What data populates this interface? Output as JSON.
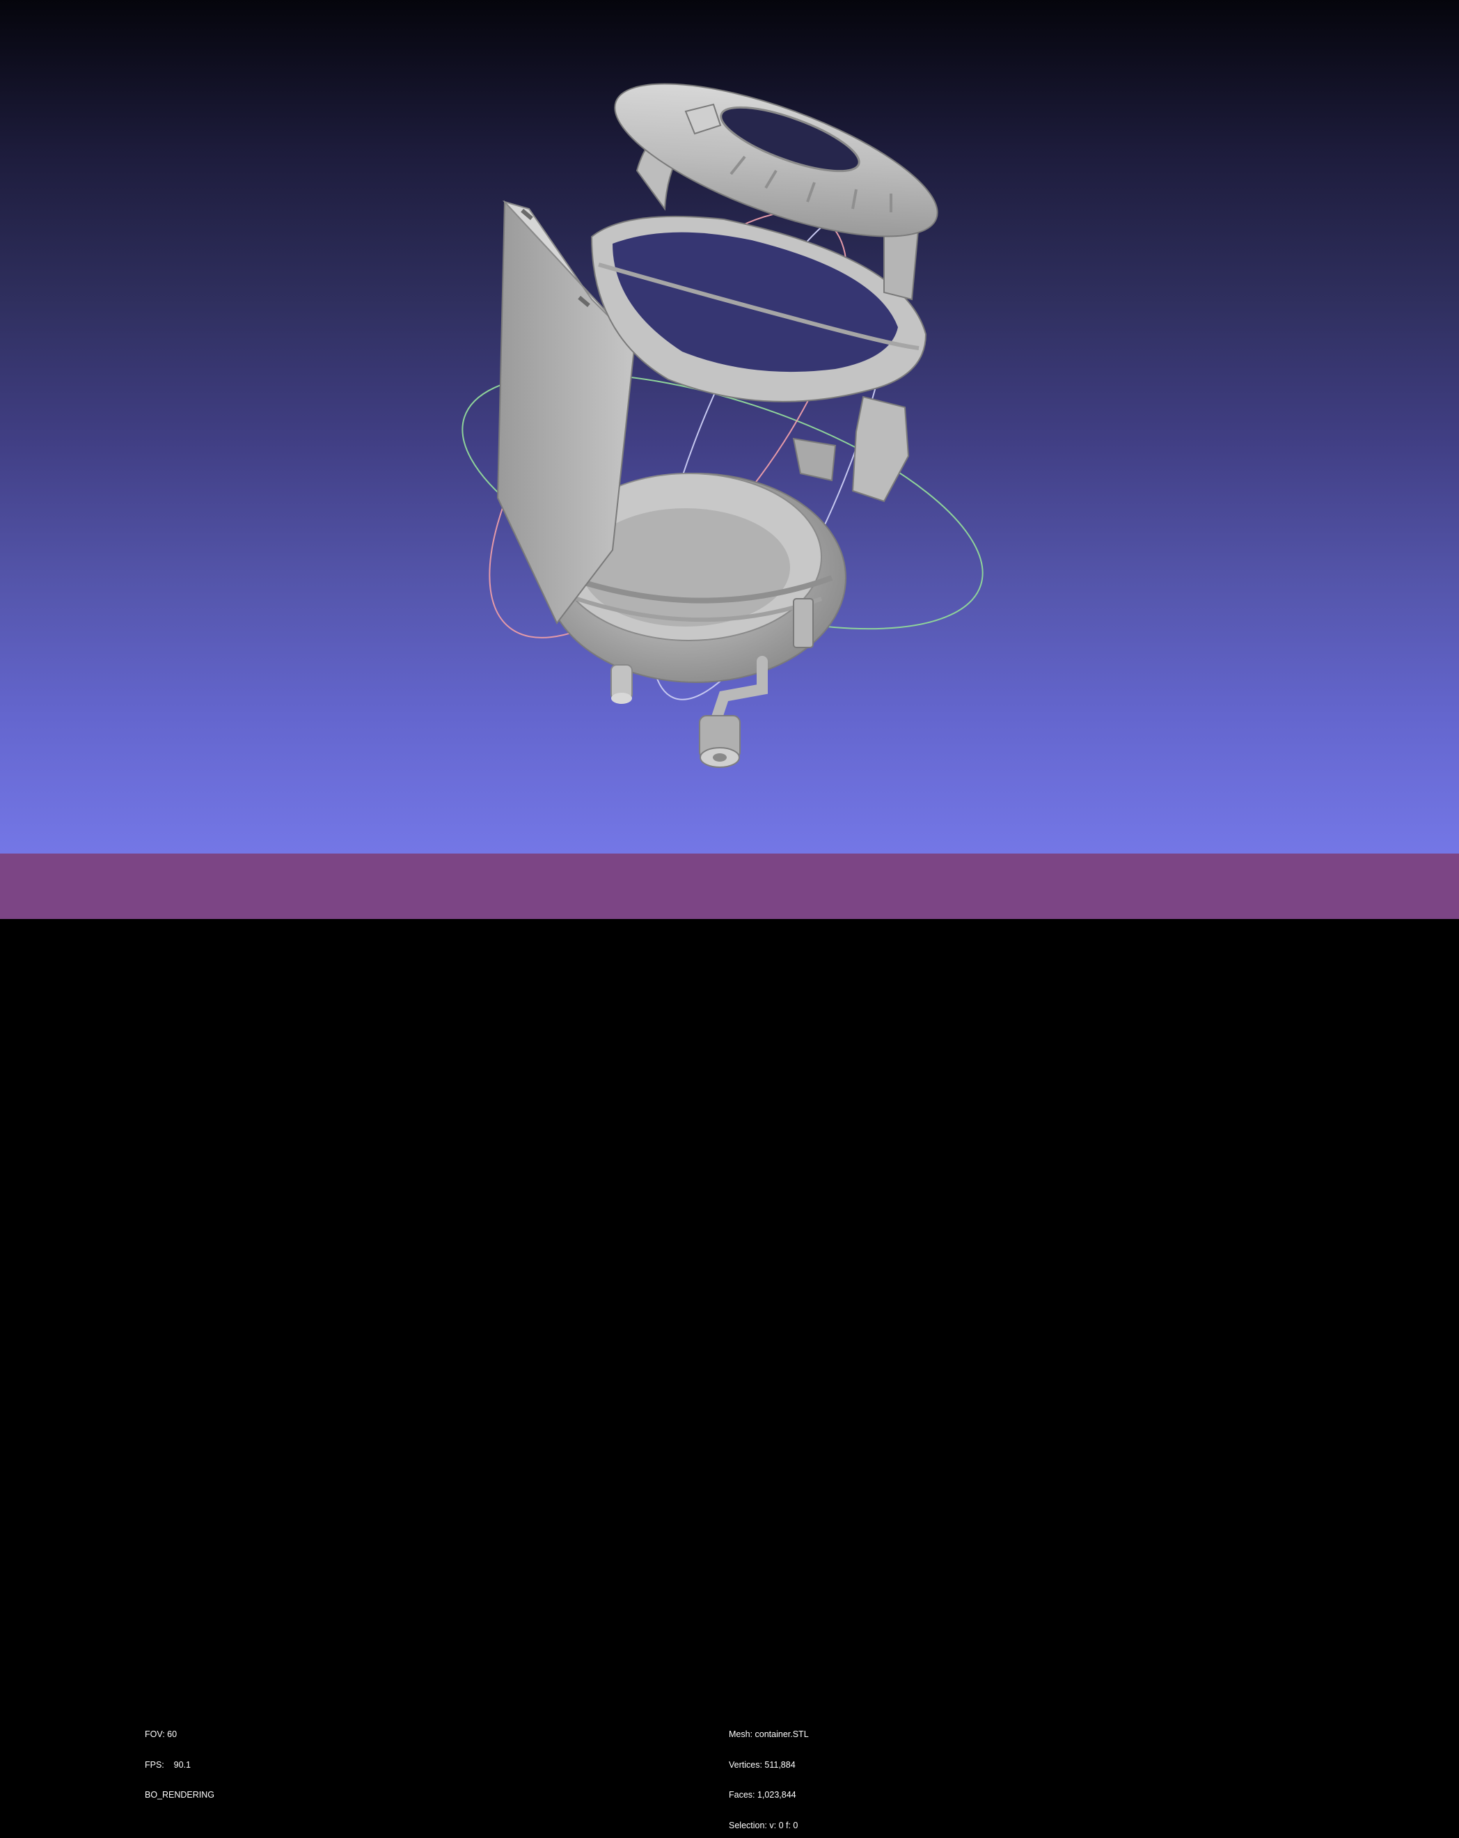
{
  "viewer": {
    "model_icon": "3d-mesh-container",
    "background_top": "#05050c",
    "background_bottom": "#7477e6",
    "statusbar_color": "#7c4585"
  },
  "render_info": {
    "fov": "FOV: 60",
    "fps": "FPS:    90.1",
    "mode": "BO_RENDERING"
  },
  "mesh_info": {
    "mesh": "Mesh: container.STL",
    "vertices": "Vertices: 511,884",
    "faces": "Faces: 1,023,844",
    "selection": "Selection: v: 0 f: 0"
  }
}
